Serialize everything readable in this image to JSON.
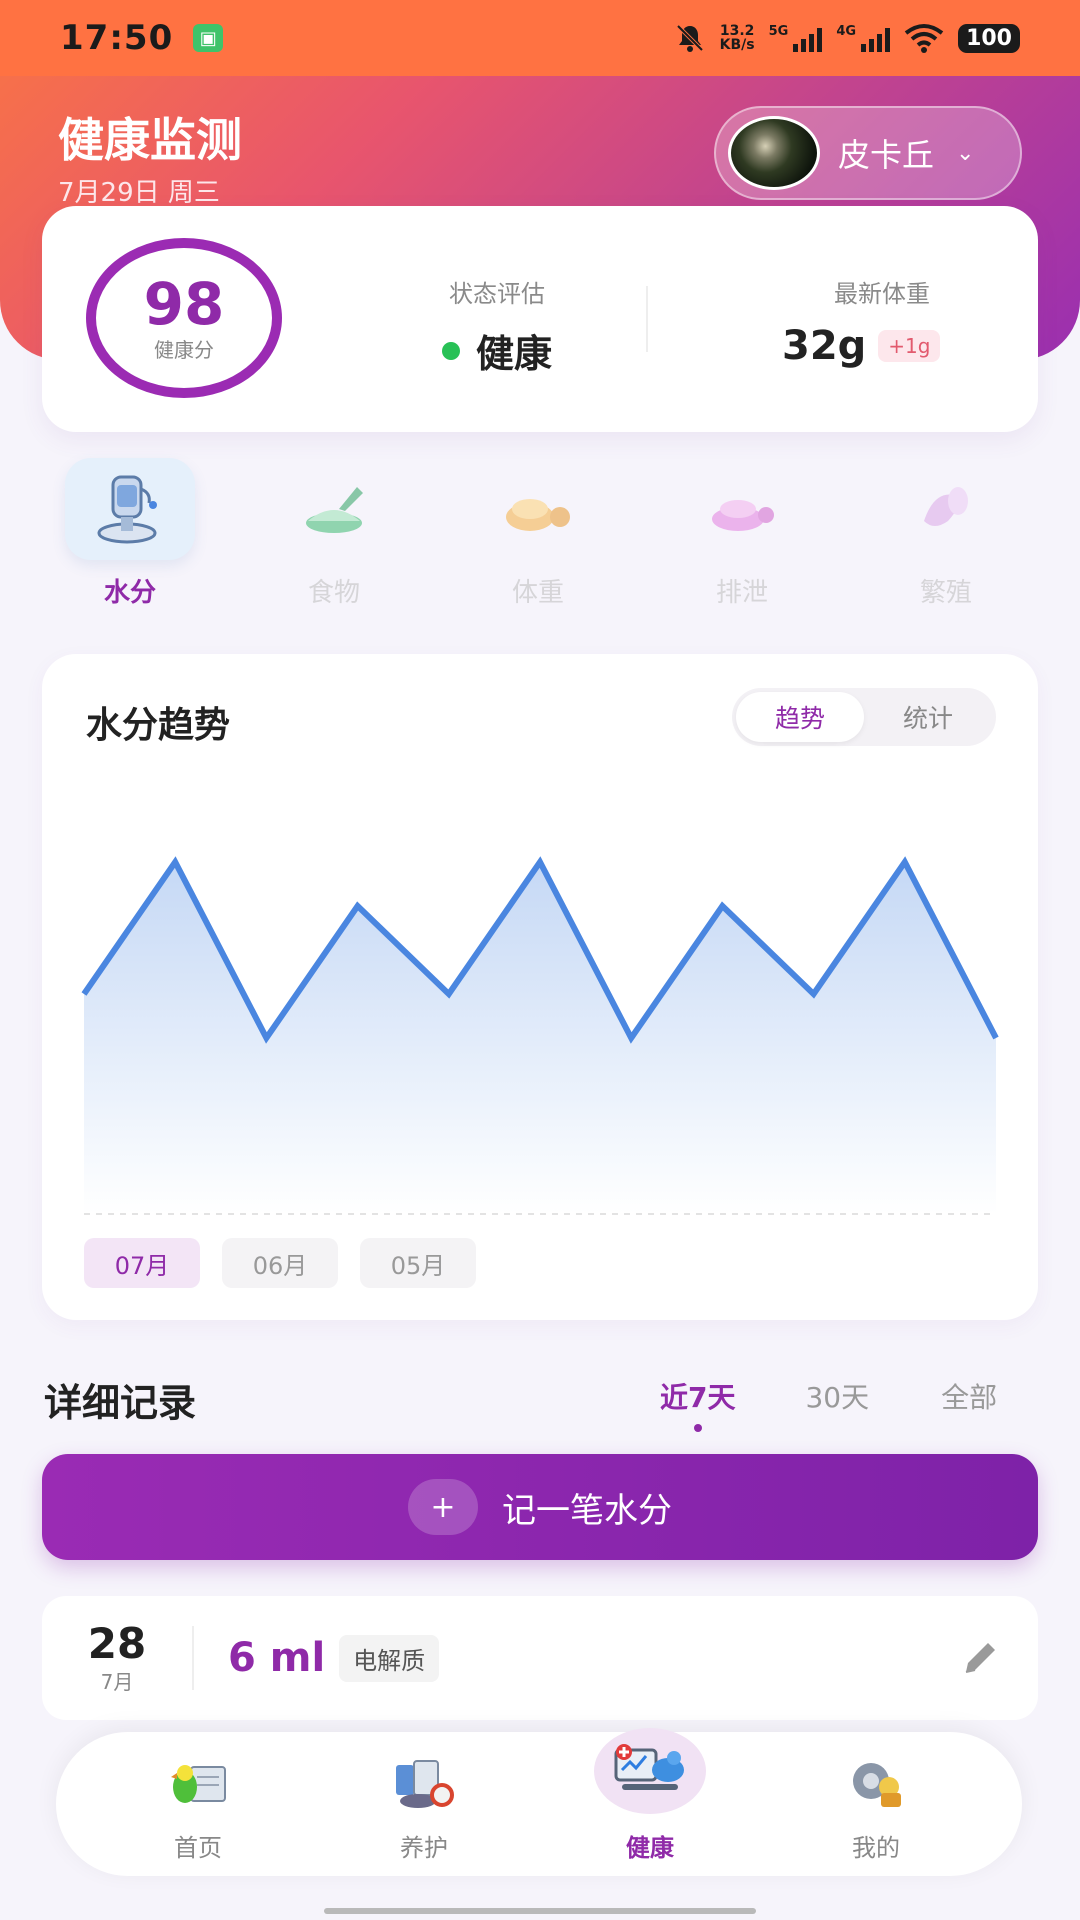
{
  "status_bar": {
    "time": "17:50",
    "net_speed_value": "13.2",
    "net_speed_unit": "KB/s",
    "sig1": "5G",
    "sig2": "4G",
    "battery": "100"
  },
  "header": {
    "title": "健康监测",
    "date": "7月29日 周三",
    "pet_name": "皮卡丘"
  },
  "summary": {
    "score": "98",
    "score_label": "健康分",
    "status_label": "状态评估",
    "status_value": "健康",
    "weight_label": "最新体重",
    "weight_value": "32g",
    "weight_delta": "+1g"
  },
  "categories": [
    {
      "label": "水分",
      "icon": "water-dispenser-icon",
      "active": true
    },
    {
      "label": "食物",
      "icon": "food-bowl-icon",
      "active": false
    },
    {
      "label": "体重",
      "icon": "weight-icon",
      "active": false
    },
    {
      "label": "排泄",
      "icon": "droppings-icon",
      "active": false
    },
    {
      "label": "繁殖",
      "icon": "egg-icon",
      "active": false
    }
  ],
  "chart_card": {
    "title": "水分趋势",
    "toggle": [
      "趋势",
      "统计"
    ],
    "months": [
      "07月",
      "06月",
      "05月"
    ]
  },
  "chart_data": {
    "type": "area",
    "title": "水分趋势",
    "y_relative": [
      5,
      8,
      4,
      7,
      5,
      8,
      4,
      7,
      5,
      8,
      4
    ],
    "ylim": [
      0,
      10
    ],
    "grid": false,
    "color": "#4a86e0"
  },
  "records": {
    "title": "详细记录",
    "range_tabs": [
      "近7天",
      "30天",
      "全部"
    ],
    "add_label": "记一笔水分",
    "add_icon": "+",
    "items": [
      {
        "day": "28",
        "month": "7月",
        "value": "6 ml",
        "tag": "电解质"
      }
    ]
  },
  "nav": [
    {
      "label": "首页",
      "icon": "parrot-home-icon"
    },
    {
      "label": "养护",
      "icon": "care-supplies-icon"
    },
    {
      "label": "健康",
      "icon": "health-monitor-icon"
    },
    {
      "label": "我的",
      "icon": "settings-profile-icon"
    }
  ],
  "colors": {
    "accent": "#8f2aa8",
    "header_start": "#f97544",
    "header_end": "#9a2fb0",
    "healthy_dot": "#28c156",
    "line": "#4a86e0"
  }
}
